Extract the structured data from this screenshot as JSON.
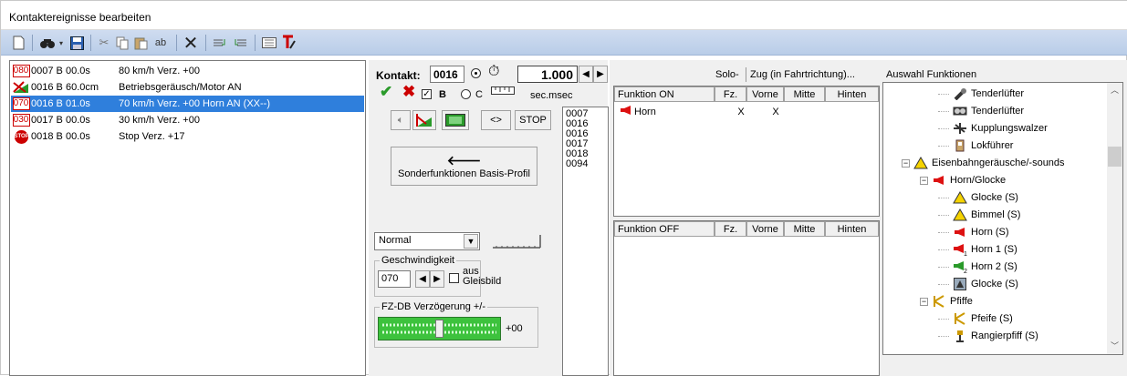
{
  "window": {
    "title": "Kontaktereignisse bearbeiten"
  },
  "events": [
    {
      "icon": "speed-080-icon",
      "icon_text": "080",
      "contact": "0007 B",
      "time": "00.0s",
      "desc": "80 km/h Verz. +00",
      "selected": false
    },
    {
      "icon": "sound-motor-icon",
      "icon_text": "",
      "contact": "0016 B",
      "time": "60.0cm",
      "desc": "Betriebsgeräusch/Motor AN",
      "selected": false
    },
    {
      "icon": "speed-070-icon",
      "icon_text": "070",
      "contact": "0016 B",
      "time": "01.0s",
      "desc": "70 km/h Verz. +00 Horn AN (XX--)",
      "selected": true
    },
    {
      "icon": "speed-030-icon",
      "icon_text": "030",
      "contact": "0017 B",
      "time": "00.0s",
      "desc": "30 km/h Verz. +00",
      "selected": false
    },
    {
      "icon": "stop-icon",
      "icon_text": "STOP",
      "contact": "0018 B",
      "time": "00.0s",
      "desc": "Stop Verz. +17",
      "selected": false
    }
  ],
  "panel": {
    "kontakt_label": "Kontakt:",
    "kontakt_value": "0016",
    "time_value": "1.000",
    "b_label": "B",
    "c_label": "C",
    "unit_label": "sec.msec",
    "stop_label": "STOP",
    "arrows_label": "<>",
    "sonder_label": "Sonderfunktionen Basis-Profil",
    "mode_value": "Normal",
    "geschw_group": "Geschwindigkeit",
    "geschw_value": "070",
    "aus_label": "aus Gleisbild",
    "fz_group": "FZ-DB Verzögerung +/-",
    "fz_value": "+00",
    "fz_level": 0.5
  },
  "contact_numbers": [
    "0007",
    "0016",
    "0016",
    "0017",
    "0018",
    "0094"
  ],
  "functions": {
    "solo_label": "Solo-",
    "zug_label": "Zug (in Fahrtrichtung)...",
    "on_headers": [
      "Funktion ON",
      "Fz.",
      "Vorne",
      "Mitte",
      "Hinten"
    ],
    "off_headers": [
      "Funktion OFF",
      "Fz.",
      "Vorne",
      "Mitte",
      "Hinten"
    ],
    "on_rows": [
      {
        "name": "Horn",
        "fz": "X",
        "vorne": "X",
        "mitte": "",
        "hinten": ""
      }
    ]
  },
  "tree": {
    "title": "Auswahl Funktionen",
    "nodes": [
      {
        "label": "Tenderlüfter",
        "icon": "tender-fan-icon",
        "level": 3,
        "expander": ""
      },
      {
        "label": "Tenderlüfter",
        "icon": "tender-fan-2-icon",
        "level": 3,
        "expander": ""
      },
      {
        "label": "Kupplungswalzer",
        "icon": "coupling-icon",
        "level": 3,
        "expander": ""
      },
      {
        "label": "Lokführer",
        "icon": "driver-icon",
        "level": 3,
        "expander": ""
      },
      {
        "label": "Eisenbahngeräusche/-sounds",
        "icon": "warning-icon",
        "level": 1,
        "expander": "−"
      },
      {
        "label": "Horn/Glocke",
        "icon": "horn-icon",
        "level": 2,
        "expander": "−"
      },
      {
        "label": "Glocke (S)",
        "icon": "bell-icon",
        "level": 3,
        "expander": ""
      },
      {
        "label": "Bimmel (S)",
        "icon": "bell-small-icon",
        "level": 3,
        "expander": ""
      },
      {
        "label": "Horn (S)",
        "icon": "horn-icon",
        "level": 3,
        "expander": ""
      },
      {
        "label": "Horn 1 (S)",
        "icon": "horn-1-icon",
        "level": 3,
        "expander": ""
      },
      {
        "label": "Horn 2 (S)",
        "icon": "horn-2-icon",
        "level": 3,
        "expander": ""
      },
      {
        "label": "Glocke (S)",
        "icon": "bell-box-icon",
        "level": 3,
        "expander": ""
      },
      {
        "label": "Pfiffe",
        "icon": "whistle-group-icon",
        "level": 2,
        "expander": "−"
      },
      {
        "label": "Pfeife (S)",
        "icon": "whistle-icon",
        "level": 3,
        "expander": ""
      },
      {
        "label": "Rangierpfiff (S)",
        "icon": "shunting-whistle-icon",
        "level": 3,
        "expander": ""
      }
    ]
  }
}
